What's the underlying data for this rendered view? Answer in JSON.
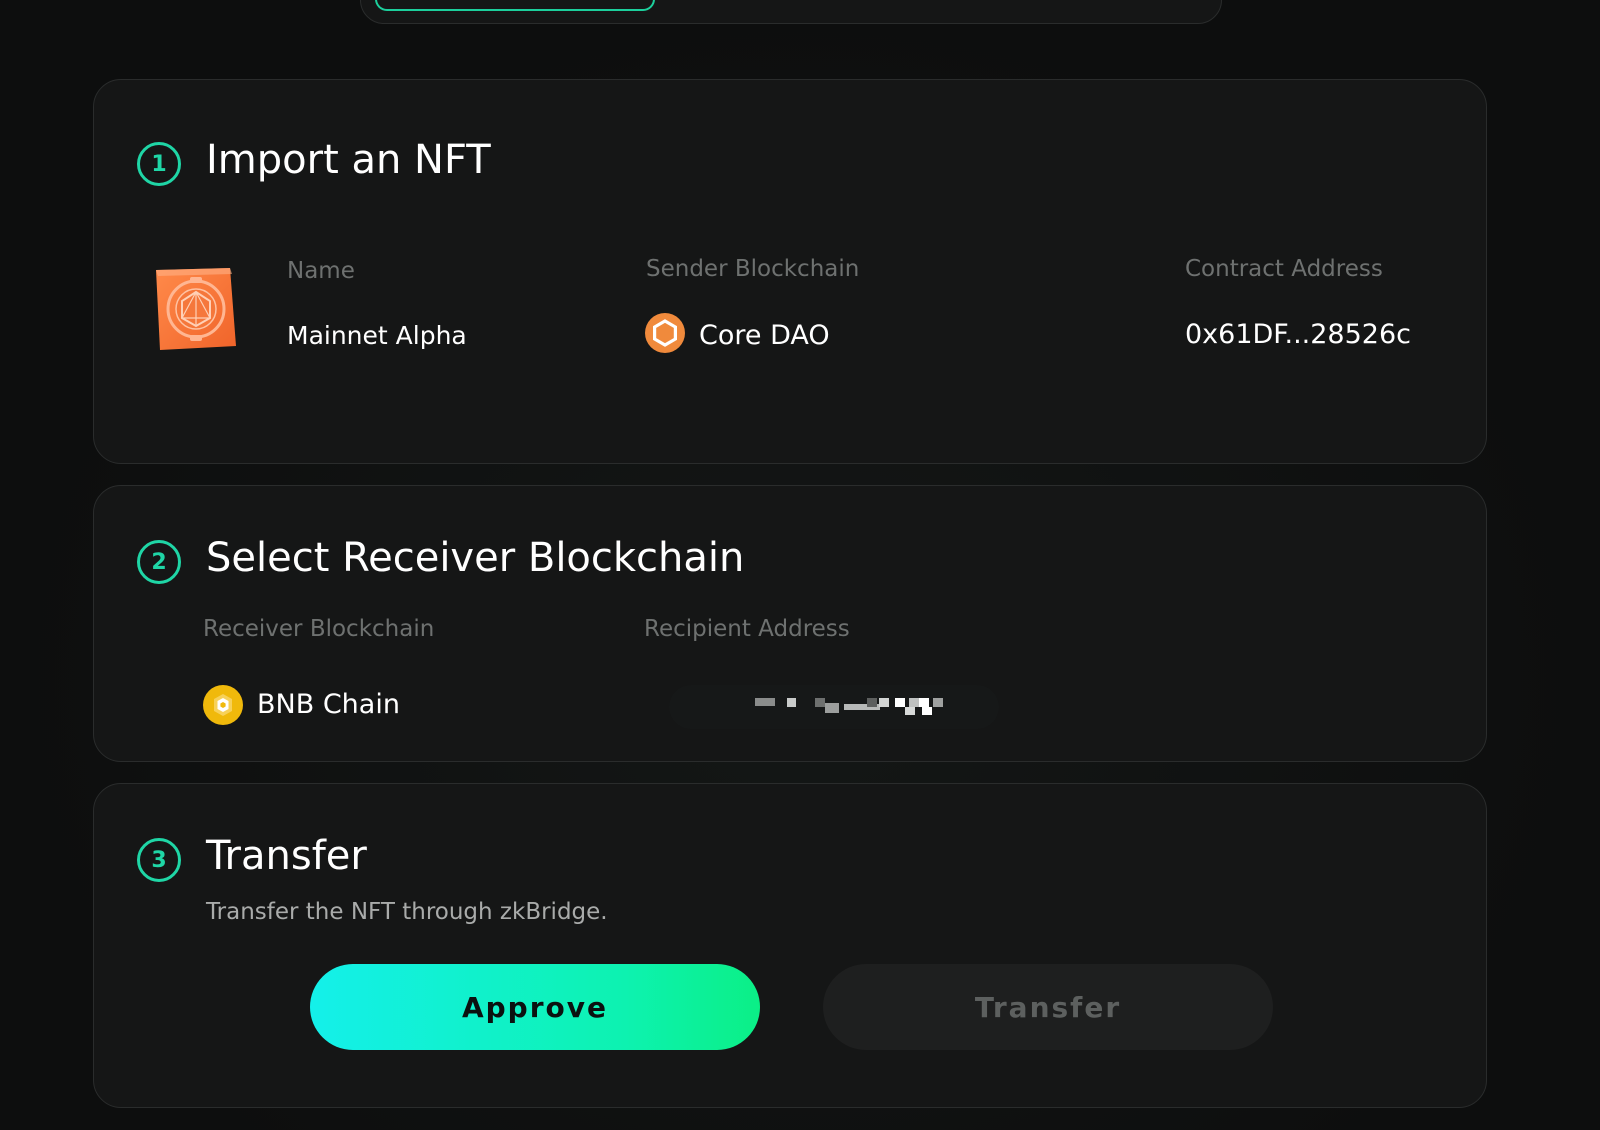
{
  "steps": {
    "import": {
      "number": "1",
      "title": "Import an NFT",
      "nft_icon": "nft-core-token-icon",
      "name_label": "Name",
      "name_value": "Mainnet Alpha",
      "sender_label": "Sender Blockchain",
      "sender_value": "Core DAO",
      "sender_icon": "core-dao-icon",
      "contract_label": "Contract Address",
      "contract_value": "0x61DF...28526c"
    },
    "receiver": {
      "number": "2",
      "title": "Select Receiver Blockchain",
      "receiver_label": "Receiver Blockchain",
      "receiver_value": "BNB Chain",
      "receiver_icon": "bnb-chain-icon",
      "recipient_label": "Recipient Address",
      "recipient_value": "[redacted]"
    },
    "transfer": {
      "number": "3",
      "title": "Transfer",
      "description": "Transfer the NFT through zkBridge.",
      "approve_label": "Approve",
      "transfer_label": "Transfer"
    }
  },
  "colors": {
    "accent": "#1fd6a6",
    "background": "#0e0f0f",
    "card": "#151616",
    "core_orange": "#f08a3c",
    "bnb_yellow": "#f0b90b"
  }
}
